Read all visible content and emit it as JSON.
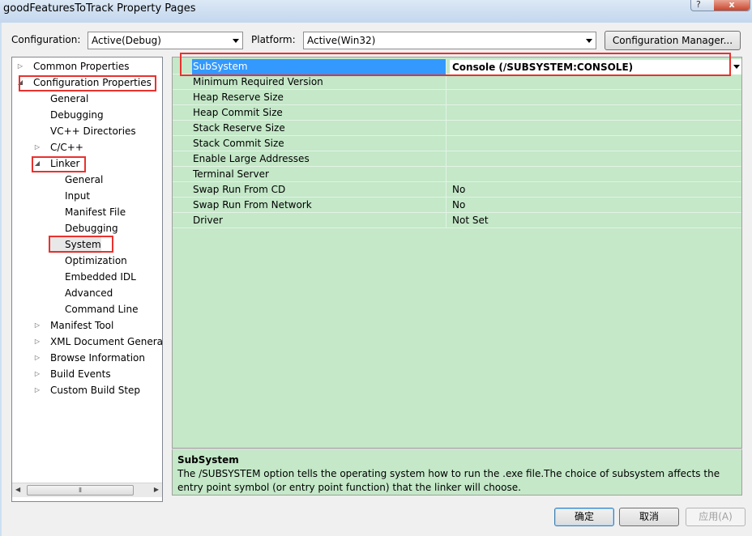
{
  "window": {
    "title": "goodFeaturesToTrack Property Pages",
    "help_glyph": "?",
    "close_glyph": "x"
  },
  "toolbar": {
    "configuration_label": "Configuration:",
    "configuration_value": "Active(Debug)",
    "platform_label": "Platform:",
    "platform_value": "Active(Win32)",
    "config_manager_label": "Configuration Manager..."
  },
  "tree": {
    "items": [
      {
        "label": "Common Properties",
        "expander": "▷"
      },
      {
        "label": "Configuration Properties",
        "expander": "◢"
      },
      {
        "label": "General",
        "expander": ""
      },
      {
        "label": "Debugging",
        "expander": ""
      },
      {
        "label": "VC++ Directories",
        "expander": ""
      },
      {
        "label": "C/C++",
        "expander": "▷"
      },
      {
        "label": "Linker",
        "expander": "◢"
      },
      {
        "label": "General",
        "expander": ""
      },
      {
        "label": "Input",
        "expander": ""
      },
      {
        "label": "Manifest File",
        "expander": ""
      },
      {
        "label": "Debugging",
        "expander": ""
      },
      {
        "label": "System",
        "expander": ""
      },
      {
        "label": "Optimization",
        "expander": ""
      },
      {
        "label": "Embedded IDL",
        "expander": ""
      },
      {
        "label": "Advanced",
        "expander": ""
      },
      {
        "label": "Command Line",
        "expander": ""
      },
      {
        "label": "Manifest Tool",
        "expander": "▷"
      },
      {
        "label": "XML Document Generat",
        "expander": "▷"
      },
      {
        "label": "Browse Information",
        "expander": "▷"
      },
      {
        "label": "Build Events",
        "expander": "▷"
      },
      {
        "label": "Custom Build Step",
        "expander": "▷"
      }
    ],
    "scroll_left": "◀",
    "scroll_thumb": "⦀",
    "scroll_right": "▶"
  },
  "grid": {
    "rows": [
      {
        "name": "SubSystem",
        "value": "Console (/SUBSYSTEM:CONSOLE)"
      },
      {
        "name": "Minimum Required Version",
        "value": ""
      },
      {
        "name": "Heap Reserve Size",
        "value": ""
      },
      {
        "name": "Heap Commit Size",
        "value": ""
      },
      {
        "name": "Stack Reserve Size",
        "value": ""
      },
      {
        "name": "Stack Commit Size",
        "value": ""
      },
      {
        "name": "Enable Large Addresses",
        "value": ""
      },
      {
        "name": "Terminal Server",
        "value": ""
      },
      {
        "name": "Swap Run From CD",
        "value": "No"
      },
      {
        "name": "Swap Run From Network",
        "value": "No"
      },
      {
        "name": "Driver",
        "value": "Not Set"
      }
    ]
  },
  "description": {
    "title": "SubSystem",
    "text": "The /SUBSYSTEM option tells the operating system how to run the .exe file.The choice of subsystem affects the entry point symbol (or entry point function) that the linker will choose."
  },
  "buttons": {
    "ok": "确定",
    "cancel": "取消",
    "apply": "应用(A)"
  },
  "colors": {
    "grid_background": "#c4e8c8",
    "selection": "#3399ff",
    "highlight": "#e8322e"
  }
}
